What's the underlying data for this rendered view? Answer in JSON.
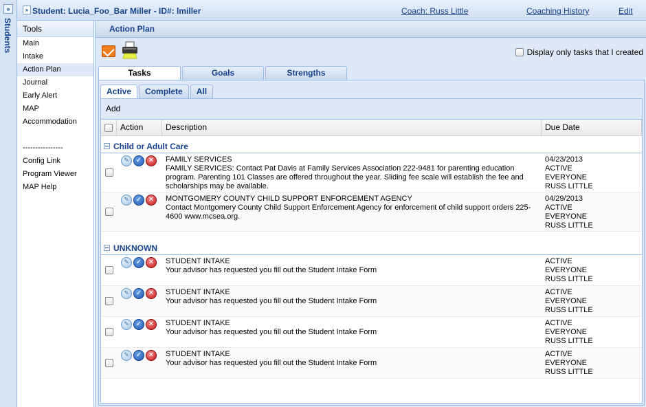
{
  "strip": {
    "title": "Students",
    "expand_glyph": "»"
  },
  "header": {
    "title": "Student: Lucia_Foo_Bar Miller - ID#: lmiller",
    "coach": "Coach: Russ Little",
    "coaching_history": "Coaching History",
    "edit": "Edit"
  },
  "tools": {
    "heading": "Tools",
    "items": [
      "Main",
      "Intake",
      "Action Plan",
      "Journal",
      "Early Alert",
      "MAP",
      "Accommodation"
    ],
    "selected": "Action Plan",
    "separator": "----------------",
    "extra": [
      "Config Link",
      "Program Viewer",
      "MAP Help"
    ]
  },
  "panel": {
    "title": "Action Plan",
    "display_only_mine": "Display only tasks that I created",
    "icons": [
      "email-icon",
      "print-icon"
    ]
  },
  "tabs": [
    "Tasks",
    "Goals",
    "Strengths"
  ],
  "subtabs": [
    "Active",
    "Complete",
    "All"
  ],
  "add_label": "Add",
  "columns": {
    "action": "Action",
    "description": "Description",
    "due": "Due Date"
  },
  "groups": [
    {
      "name": "Child or Adult Care",
      "rows": [
        {
          "title": "FAMILY SERVICES",
          "text": "FAMILY SERVICES: Contact Pat Davis at Family Services Association 222-9481 for parenting education program. Parenting 101 Classes are offered throughout the year. Sliding fee scale will establish the fee and scholarships may be available.",
          "due": [
            "04/23/2013",
            "ACTIVE",
            "EVERYONE",
            "RUSS LITTLE"
          ]
        },
        {
          "title": "MONTGOMERY COUNTY CHILD SUPPORT ENFORCEMENT AGENCY",
          "text": "Contact Montgomery County Child Support Enforcement Agency for enforcement of child support orders 225-4600 www.mcsea.org.",
          "due": [
            "04/29/2013",
            "ACTIVE",
            "EVERYONE",
            "RUSS LITTLE"
          ]
        }
      ]
    },
    {
      "name": "UNKNOWN",
      "rows": [
        {
          "title": "STUDENT INTAKE",
          "text": "Your advisor has requested you fill out the Student Intake Form",
          "due": [
            "ACTIVE",
            "EVERYONE",
            "RUSS LITTLE"
          ]
        },
        {
          "title": "STUDENT INTAKE",
          "text": "Your advisor has requested you fill out the Student Intake Form",
          "due": [
            "ACTIVE",
            "EVERYONE",
            "RUSS LITTLE"
          ]
        },
        {
          "title": "STUDENT INTAKE",
          "text": "Your advisor has requested you fill out the Student Intake Form",
          "due": [
            "ACTIVE",
            "EVERYONE",
            "RUSS LITTLE"
          ]
        },
        {
          "title": "STUDENT INTAKE",
          "text": "Your advisor has requested you fill out the Student Intake Form",
          "due": [
            "ACTIVE",
            "EVERYONE",
            "RUSS LITTLE"
          ]
        }
      ]
    }
  ],
  "action_icons": {
    "edit": "✎",
    "ok": "✓",
    "del": "✕"
  },
  "colors": {
    "accent": "#15428b",
    "panel_bg": "#dfe8f6",
    "border": "#99bbe8"
  }
}
